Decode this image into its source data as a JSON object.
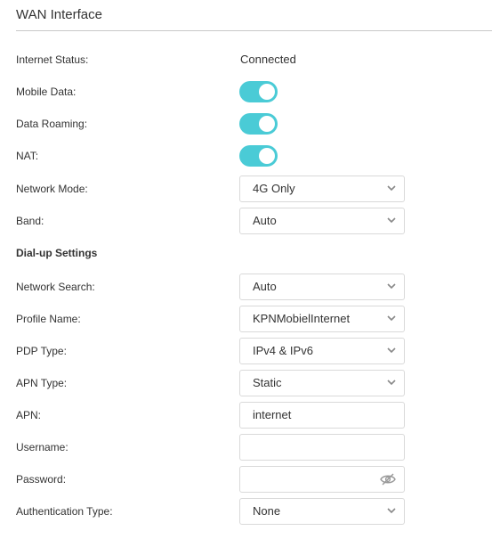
{
  "section": {
    "title": "WAN Interface"
  },
  "rows": {
    "internet_status": {
      "label": "Internet Status:",
      "value": "Connected"
    },
    "mobile_data": {
      "label": "Mobile Data:",
      "enabled": true
    },
    "data_roaming": {
      "label": "Data Roaming:",
      "enabled": true
    },
    "nat": {
      "label": "NAT:",
      "enabled": true
    },
    "network_mode": {
      "label": "Network Mode:",
      "value": "4G Only"
    },
    "band": {
      "label": "Band:",
      "value": "Auto"
    }
  },
  "dialup": {
    "heading": "Dial-up Settings",
    "network_search": {
      "label": "Network Search:",
      "value": "Auto"
    },
    "profile_name": {
      "label": "Profile Name:",
      "value": "KPNMobielInternet"
    },
    "pdp_type": {
      "label": "PDP Type:",
      "value": "IPv4 & IPv6"
    },
    "apn_type": {
      "label": "APN Type:",
      "value": "Static"
    },
    "apn": {
      "label": "APN:",
      "value": "internet"
    },
    "username": {
      "label": "Username:",
      "value": ""
    },
    "password": {
      "label": "Password:",
      "value": "",
      "icon": "eye-slash-icon"
    },
    "auth_type": {
      "label": "Authentication Type:",
      "value": "None"
    }
  },
  "colors": {
    "toggle_on": "#4acbd6",
    "border": "#d9d9d9",
    "text": "#333333",
    "chevron": "#888888"
  },
  "icons": {
    "dropdown": "chevron-down-icon",
    "password_visibility": "eye-slash-icon"
  }
}
